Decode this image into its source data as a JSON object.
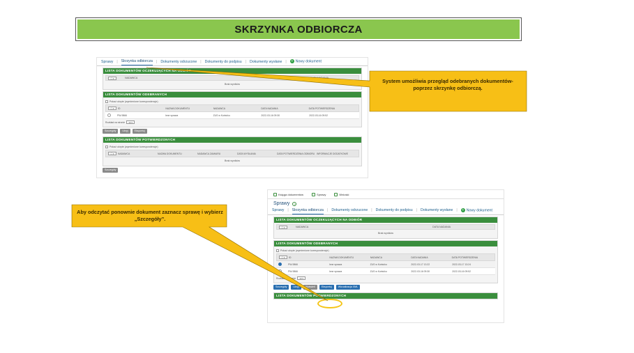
{
  "banner": {
    "title": "SKRZYNKA ODBIORCZA"
  },
  "callouts": {
    "first": "System umożliwia przegląd odebranych dokumentów- poprzez skrzynkę odbiorczą.",
    "second": "Aby odczytać ponownie dokument zaznacz sprawę i wybierz „Szczegóły”."
  },
  "shot1": {
    "tabs": [
      "Sprawy",
      "Skrzynka odbiorcza",
      "Dokumenty odrzucone",
      "Dokumenty do podpisu",
      "Dokumenty wysłane",
      "Nowy dokument"
    ],
    "active_tab_index": 1,
    "panel_waiting": {
      "title": "LISTA DOKUMENTÓW OCZEKUJĄCYCH NA ODBIÓR",
      "columns": [
        "NADAWCA",
        "DATA NADANIA"
      ],
      "empty": "Brak wyników"
    },
    "panel_received": {
      "title": "LISTA DOKUMENTÓW ODEBRANYCH",
      "filter_label": "Pokaż ukryte (wymienione korespondencje)",
      "columns": [
        "NAZWA DOKUMENTU",
        "NADAWCA",
        "DATA NADANIA",
        "DATA POTWIERDZENIA"
      ],
      "rows": [
        {
          "id": "PW-9866",
          "name": "Inne sprawa",
          "sender": "ZUS w Kutnicku",
          "sent": "2022-03-16 09:30",
          "confirmed": "2022-03-16 09:52"
        }
      ],
      "pager": "Rozkład na stronie"
    },
    "buttons": [
      "Szczegóły",
      "Ukryj",
      "Eksportuj"
    ],
    "panel_confirmed": {
      "title": "LISTA DOKUMENTÓW POTWIERDZONYCH",
      "filter_label": "Pokaż ukryte (wymienione korespondencje)",
      "columns": [
        "NADAWCA",
        "NAZWA DOKUMENTU",
        "NADAWCA ZAMIARU",
        "DATA WYSŁANIA",
        "DATA POTWIERDZENIA ODBIORU",
        "INFORMACJE DODATKOWE"
      ],
      "empty": "Brak wyników"
    },
    "bottom_button": "Szczegóły"
  },
  "shot2": {
    "topnav": [
      "Księga dokumentów",
      "Sprawy",
      "Wnioski"
    ],
    "page_title": "Sprawy",
    "tabs": [
      "Sprawy",
      "Skrzynka odbiorcza",
      "Dokumenty odrzucone",
      "Dokumenty do podpisu",
      "Dokumenty wysłane",
      "Nowy dokument"
    ],
    "panel_waiting": {
      "title": "LISTA DOKUMENTÓW OCZEKUJĄCYCH NA ODBIÓR",
      "columns": [
        "NADAWCA",
        "DATA NADANIA"
      ],
      "empty": "Brak wyników"
    },
    "panel_received": {
      "title": "LISTA DOKUMENTÓW ODEBRANYCH",
      "filter_label": "Pokaż ukryte (wymienione korespondencje)",
      "columns": [
        "NAZWA DOKUMENTU",
        "NADAWCA",
        "DATA NADANIA",
        "DATA POTWIERDZENIA"
      ],
      "rows": [
        {
          "id": "PW-9866",
          "name": "Inne sprawa",
          "sender": "ZUS w Kutnicku",
          "sent": "2022-03-17 13:22",
          "confirmed": "2022-03-17 13:24"
        },
        {
          "id": "PW-9866",
          "name": "Inne sprawa",
          "sender": "ZUS w Kutnicku",
          "sent": "2022-03-16 09:30",
          "confirmed": "2022-03-16 09:52"
        }
      ],
      "pager": "Rozkład na stronie"
    },
    "buttons": [
      "Szczegóły",
      "Ukryj",
      "Wyświetl",
      "Eksportuj",
      "Wizualizacja XML"
    ],
    "panel_confirmed": {
      "title": "LISTA DOKUMENTÓW POTWIERDZONYCH"
    }
  },
  "colors": {
    "banner": "#8ac64e",
    "panel_header": "#3a8e3d",
    "callout": "#f7bf16",
    "highlight": "#f5c518"
  }
}
